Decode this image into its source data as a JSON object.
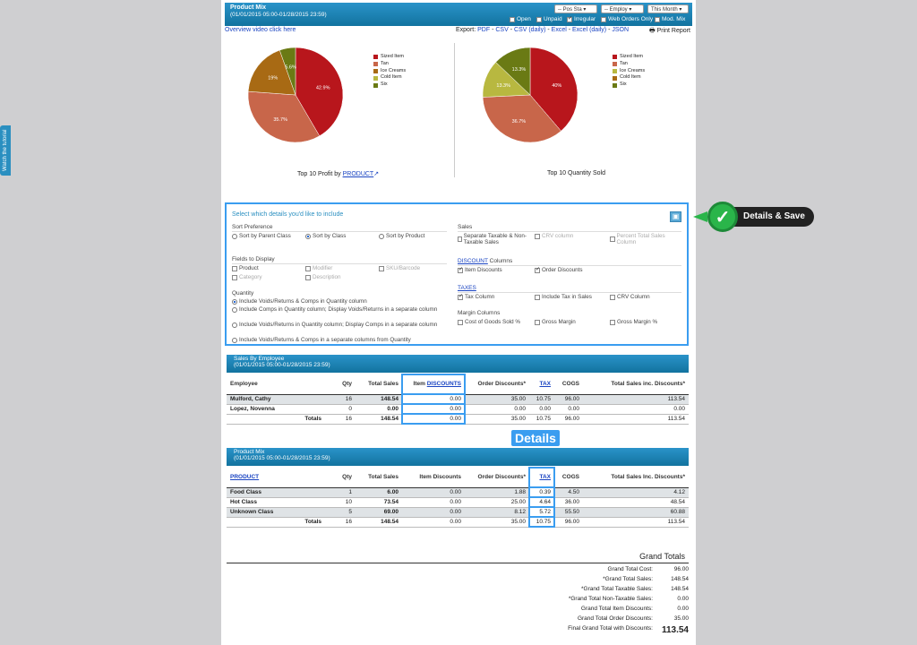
{
  "side_tab": "Watch the tutorial",
  "header": {
    "title": "Product Mix",
    "date_range": "(01/01/2015 05:00-01/28/2015 23:59)",
    "selects": [
      "-- Pos Sta",
      "-- Employ",
      "This Month"
    ],
    "checkboxes": [
      {
        "label": "Open",
        "checked": false
      },
      {
        "label": "Unpaid",
        "checked": false
      },
      {
        "label": "Irregular",
        "checked": true
      },
      {
        "label": "Web Orders Only",
        "checked": false
      },
      {
        "label": "Mod. Mix",
        "checked": false
      }
    ]
  },
  "links": {
    "overview": "Overview video click here",
    "export_prefix": "Export:",
    "export_items": [
      "PDF",
      "CSV",
      "CSV (daily)",
      "Excel",
      "Excel (daily)",
      "JSON"
    ],
    "print": "Print Report"
  },
  "chart_data": [
    {
      "type": "pie",
      "title": "Top 10 Profit by",
      "title_link": "PRODUCT",
      "labels": [
        "Sized Item",
        "Tan",
        "Ice Creams",
        "Cold Item",
        "Six"
      ],
      "colors": [
        "#b8161c",
        "#c8664a",
        "#a86a14",
        "#b8b840",
        "#6a7a14"
      ],
      "values": [
        42.9,
        35.7,
        19,
        0,
        5.6
      ],
      "slice_labels": [
        "42.9%",
        "35.7%",
        "19%",
        "",
        "5.6%"
      ]
    },
    {
      "type": "pie",
      "title": "Top 10 Quantity Sold",
      "labels": [
        "Sized Item",
        "Tan",
        "Ice Creams",
        "Cold Item",
        "Six"
      ],
      "colors": [
        "#b8161c",
        "#c8664a",
        "#b8b840",
        "#a86a14",
        "#6a7a14"
      ],
      "values": [
        40,
        36.7,
        13.3,
        0,
        13.3
      ],
      "slice_labels": [
        "40%",
        "36.7%",
        "13.3%",
        "",
        "13.3%"
      ]
    }
  ],
  "details": {
    "header": "Select which details you'd like to include",
    "sort_label": "Sort Preference",
    "sort_options": [
      "Sort by Parent Class",
      "Sort by Class",
      "Sort by Product"
    ],
    "fields_label": "Fields to Display",
    "fields": [
      "Product",
      "Modifier",
      "SKU/Barcode",
      "Category",
      "Description"
    ],
    "quantity_label": "Quantity",
    "quantity_options": [
      "Include Voids/Returns & Comps in Quantity column",
      "Include Comps in Quantity column; Display Voids/Returns in a separate column",
      "Include Voids/Returns in Quantity column; Display Comps in a separate column",
      "Include Voids/Returns & Comps in a separate columns from Quantity"
    ],
    "sales_label": "Sales",
    "sales_options": [
      "Separate Taxable & Non-Taxable Sales",
      "CRV column",
      "Percent Total Sales Column"
    ],
    "discount_link": "DISCOUNT",
    "discount_suffix": "Columns",
    "discount_options": [
      "Item Discounts",
      "Order Discounts"
    ],
    "taxes_link": "TAXES",
    "tax_options": [
      "Tax Column",
      "Include Tax in Sales",
      "CRV Column"
    ],
    "margin_label": "Margin Columns",
    "margin_options": [
      "Cost of Goods Sold %",
      "Gross Margin",
      "Gross Margin %"
    ]
  },
  "sales_by_employee": {
    "title": "Sales By Employee",
    "date_range": "(01/01/2015 05:00-01/28/2015 23:59)",
    "columns": [
      "Employee",
      "Qty",
      "Total Sales",
      "Item DISCOUNTS",
      "Order Discounts*",
      "TAX",
      "COGS",
      "Total Sales inc. Discounts*"
    ],
    "rows": [
      [
        "Mulford, Cathy",
        "16",
        "148.54",
        "0.00",
        "35.00",
        "10.75",
        "96.00",
        "113.54"
      ],
      [
        "Lopez, Novenna",
        "0",
        "0.00",
        "0.00",
        "0.00",
        "0.00",
        "0.00",
        "0.00"
      ],
      [
        "Totals",
        "16",
        "148.54",
        "0.00",
        "35.00",
        "10.75",
        "96.00",
        "113.54"
      ]
    ]
  },
  "product_mix": {
    "title": "Product Mix",
    "date_range": "(01/01/2015 05:00-01/28/2015 23:59)",
    "columns": [
      "PRODUCT",
      "Qty",
      "Total Sales",
      "Item Discounts",
      "Order Discounts*",
      "TAX",
      "COGS",
      "Total Sales Inc. Discounts*"
    ],
    "rows": [
      [
        "Food Class",
        "1",
        "6.00",
        "0.00",
        "1.88",
        "0.39",
        "4.50",
        "4.12"
      ],
      [
        "Hot Class",
        "10",
        "73.54",
        "0.00",
        "25.00",
        "4.64",
        "36.00",
        "48.54"
      ],
      [
        "Unknown Class",
        "5",
        "69.00",
        "0.00",
        "8.12",
        "5.72",
        "55.50",
        "60.88"
      ],
      [
        "Totals",
        "16",
        "148.54",
        "0.00",
        "35.00",
        "10.75",
        "96.00",
        "113.54"
      ]
    ]
  },
  "grand_totals": {
    "title": "Grand Totals",
    "rows": [
      {
        "k": "Grand Total Cost:",
        "v": "96.00"
      },
      {
        "k": "*Grand Total Sales:",
        "v": "148.54"
      },
      {
        "k": "*Grand Total Taxable Sales:",
        "v": "148.54"
      },
      {
        "k": "*Grand Total Non-Taxable Sales:",
        "v": "0.00"
      },
      {
        "k": "Grand Total Item Discounts:",
        "v": "0.00"
      },
      {
        "k": "Grand Total Order Discounts:",
        "v": "35.00"
      },
      {
        "k": "Final Grand Total with Discounts:",
        "v": "113.54"
      }
    ]
  },
  "callouts": {
    "details_save": "Details & Save",
    "details": "Details"
  }
}
